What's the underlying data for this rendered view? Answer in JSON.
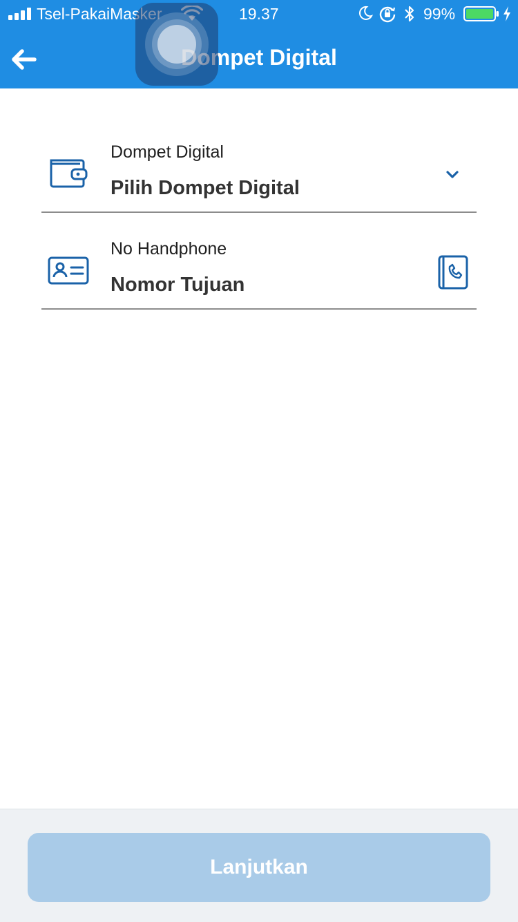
{
  "status_bar": {
    "carrier": "Tsel-PakaiMasker",
    "time": "19.37",
    "battery_percent": "99%"
  },
  "nav": {
    "title": "Dompet Digital"
  },
  "form": {
    "wallet": {
      "label": "Dompet Digital",
      "value": "Pilih Dompet Digital"
    },
    "phone": {
      "label": "No Handphone",
      "placeholder": "Nomor Tujuan"
    }
  },
  "footer": {
    "continue_label": "Lanjutkan"
  },
  "colors": {
    "header": "#1f8de3",
    "icon": "#1a62a8",
    "button_disabled": "#a9cbe8",
    "battery_fill": "#4cd964"
  }
}
